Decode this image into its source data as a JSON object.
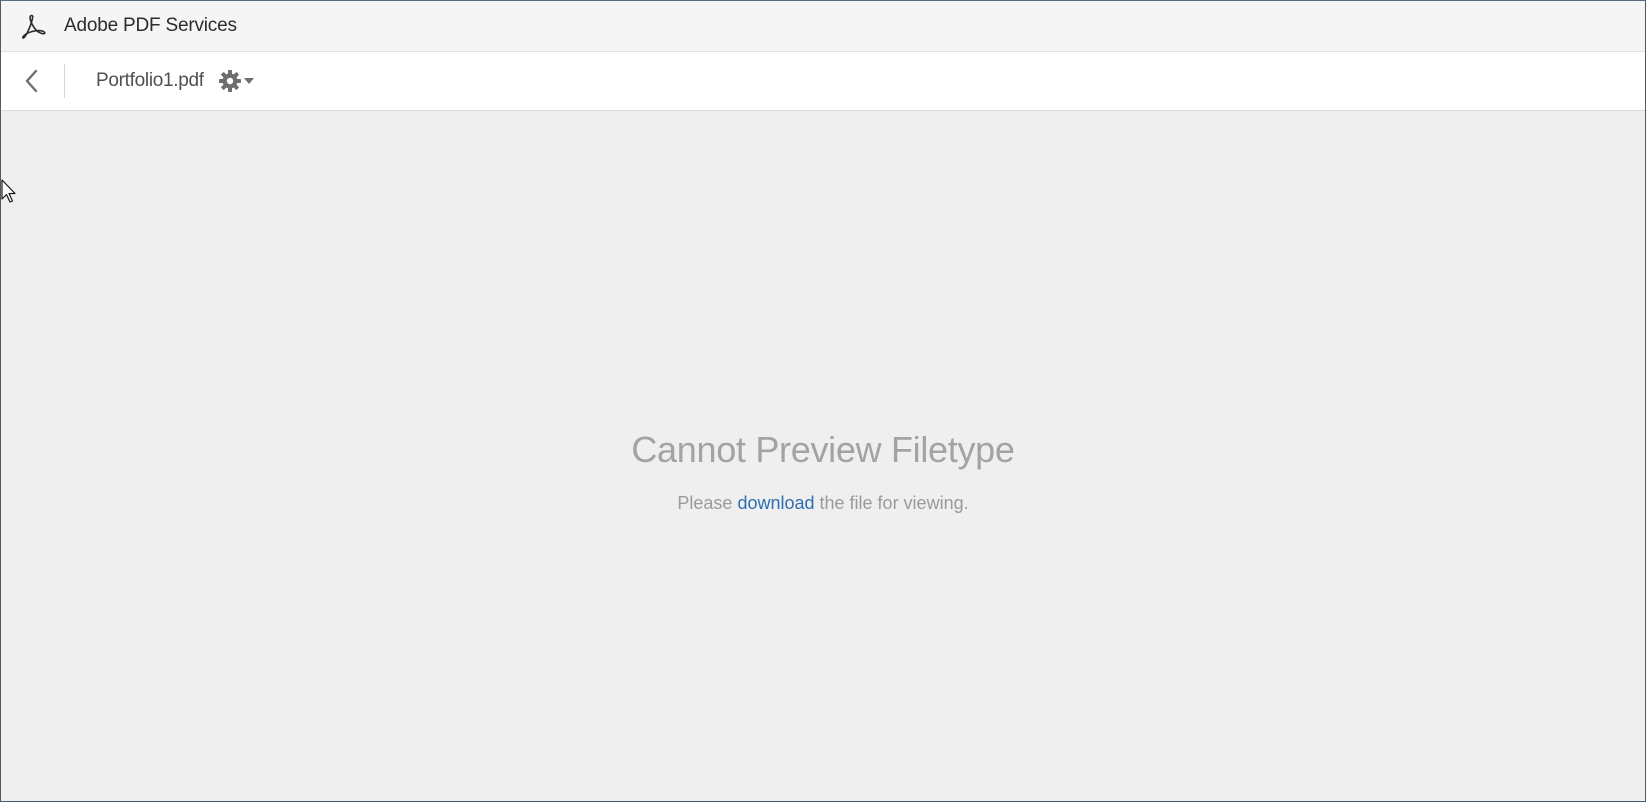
{
  "app": {
    "title": "Adobe PDF Services",
    "logo_icon": "acrobat-logo-icon"
  },
  "toolbar": {
    "back_icon": "chevron-left-icon",
    "file_name": "Portfolio1.pdf",
    "settings_icon": "gear-icon",
    "settings_caret_icon": "caret-down-icon"
  },
  "preview": {
    "title": "Cannot Preview Filetype",
    "body_prefix": "Please ",
    "download_link": "download",
    "body_suffix": " the file for viewing."
  },
  "colors": {
    "link": "#2d6fb3",
    "content_background": "#efefef",
    "app_bar_background": "#f5f5f5"
  }
}
